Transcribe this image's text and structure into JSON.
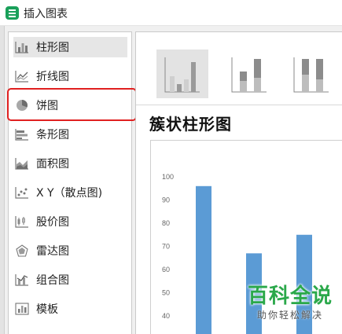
{
  "window": {
    "title": "插入图表"
  },
  "sidebar": {
    "items": [
      {
        "label": "柱形图",
        "icon": "bar-chart-icon"
      },
      {
        "label": "折线图",
        "icon": "line-chart-icon"
      },
      {
        "label": "饼图",
        "icon": "pie-chart-icon"
      },
      {
        "label": "条形图",
        "icon": "horizontal-bar-chart-icon"
      },
      {
        "label": "面积图",
        "icon": "area-chart-icon"
      },
      {
        "label": "X Y（散点图)",
        "icon": "scatter-chart-icon"
      },
      {
        "label": "股价图",
        "icon": "stock-chart-icon"
      },
      {
        "label": "雷达图",
        "icon": "radar-chart-icon"
      },
      {
        "label": "组合图",
        "icon": "combo-chart-icon"
      },
      {
        "label": "模板",
        "icon": "template-icon"
      }
    ],
    "selected_index": 0,
    "highlighted_index": 2
  },
  "main": {
    "subtypes": [
      "clustered-column-icon",
      "stacked-column-icon",
      "percent-stacked-column-icon"
    ],
    "selected_subtype": 0,
    "chart_title": "簇状柱形图"
  },
  "chart_data": {
    "type": "bar",
    "y_ticks": [
      "100",
      "90",
      "80",
      "70",
      "60",
      "50",
      "40"
    ],
    "values": [
      96,
      67,
      75
    ],
    "ylim": [
      40,
      100
    ],
    "grid": false,
    "bar_color": "#5b9bd5"
  },
  "watermark": {
    "main": "百科全说",
    "sub": "助你轻松解决"
  },
  "colors": {
    "highlight": "#e02020",
    "watermark": "#2aa84a",
    "app_icon": "#1aa05a"
  }
}
